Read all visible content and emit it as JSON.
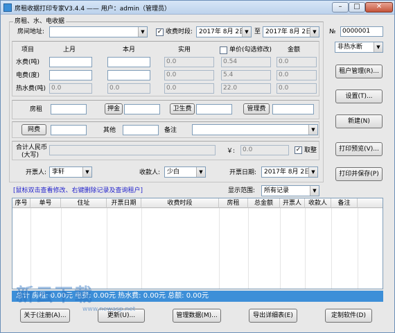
{
  "window": {
    "title": "房租收据打印专家V3.4.4 —— 用户：admin（管理员）"
  },
  "group_title": "房租、水、电收据",
  "address": {
    "label": "房间地址:",
    "value": ""
  },
  "period": {
    "checkbox_checked": true,
    "label": "收费时段:",
    "start": "2017年 8月 2日",
    "to": "至",
    "end": "2017年 8月 2日"
  },
  "receipt_no": {
    "label": "№",
    "value": "0000001"
  },
  "meter_headers": {
    "item": "项目",
    "last": "上月",
    "this": "本月",
    "actual": "实用",
    "price_check": "单价(勾选修改)",
    "amount": "金额"
  },
  "meters": [
    {
      "label": "水费(吨)",
      "last": "",
      "this": "",
      "actual": "0.0",
      "price": "0.54",
      "amount": "0.0",
      "disabled": false
    },
    {
      "label": "电费(度)",
      "last": "",
      "this": "",
      "actual": "0.0",
      "price": "5.4",
      "amount": "0.0",
      "disabled": false
    },
    {
      "label": "热水费(吨)",
      "last": "0.0",
      "this": "0.0",
      "actual": "0.0",
      "price": "22.0",
      "amount": "0.0",
      "disabled": true
    }
  ],
  "hot_water_select": "非热水断",
  "fees": {
    "rent": "房租",
    "deposit": "押金",
    "sanitation": "卫生费",
    "management": "管理费",
    "network": "网费",
    "other": "其他",
    "remark": "备注"
  },
  "total": {
    "label_cn": "合计人民币",
    "label_sub": "(大写)",
    "yen": "￥:",
    "value": "0.0",
    "paid_label": "取整",
    "paid_checked": true
  },
  "people": {
    "issuer_label": "开票人:",
    "issuer": "李轩",
    "payee_label": "收款人:",
    "payee": "少白",
    "date_label": "开票日期:",
    "date": "2017年 8月 2日"
  },
  "right_buttons": [
    "租户管理(R)...",
    "设置(T)...",
    "新建(N)",
    "打印预览(V)...",
    "打印并保存(P)"
  ],
  "hint": "[鼠标双击查看修改、右键删除记录及查询租户]",
  "range": {
    "label": "显示范围:",
    "value": "所有记录"
  },
  "grid_columns": [
    "序号",
    "单号",
    "住址",
    "开票日期",
    "收费时段",
    "房租",
    "总金额",
    "开票人",
    "收款人",
    "备注"
  ],
  "status_bar": "总计 房租: 0.00元   电费: 0.00元   热水费: 0.00元   总额: 0.00元",
  "bottom_buttons": [
    "关于(注册(A)...",
    "更新(U)...",
    "管理数据(M)...",
    "导出详细表(E)",
    "定制软件(D)"
  ],
  "watermark": {
    "text": "新云下载",
    "url": "www.newasp.net"
  },
  "titlebar_controls": {
    "minimize": "–",
    "maximize": "□",
    "close": "✕"
  }
}
